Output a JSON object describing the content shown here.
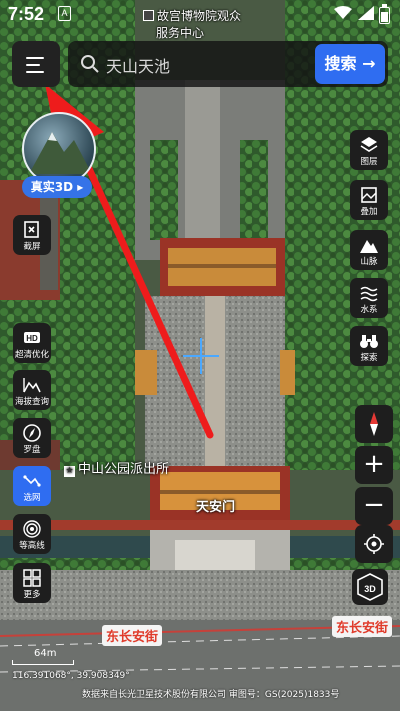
{
  "status_bar": {
    "time": "7:52",
    "notif": "A"
  },
  "map": {
    "top_poi": [
      "故宫博物院观众",
      "服务中心"
    ],
    "police_label": "中山公园派出所",
    "gate_label": "天安门",
    "road_label_left": "东长安街",
    "road_label_right": "东长安街",
    "scale_label": "64m",
    "coordinates": "116.391068°, 39.908349°",
    "credit": "数据来自长光卫星技术股份有限公司 审图号：GS(2025)1833号"
  },
  "search": {
    "value": "天山天池",
    "button": "搜索 →"
  },
  "real3d": {
    "label": "真实3D ▸"
  },
  "left_tools": [
    {
      "label": "截屏",
      "icon": "screenshot-icon"
    },
    {
      "label": "超清优化",
      "icon": "hd-icon"
    },
    {
      "label": "海拔查询",
      "icon": "altitude-icon"
    },
    {
      "label": "罗盘",
      "icon": "compass-icon"
    },
    {
      "label": "选网",
      "icon": "net-icon"
    },
    {
      "label": "等高线",
      "icon": "contour-icon"
    },
    {
      "label": "更多",
      "icon": "more-icon"
    }
  ],
  "right_tools": [
    {
      "label": "图层",
      "icon": "layers-icon"
    },
    {
      "label": "叠加",
      "icon": "overlay-icon"
    },
    {
      "label": "山脉",
      "icon": "mountain-icon"
    },
    {
      "label": "水系",
      "icon": "water-icon"
    },
    {
      "label": "探索",
      "icon": "binoculars-icon"
    }
  ],
  "map_controls": {
    "zoom_in": "+",
    "zoom_out": "−",
    "view_3d": "3D"
  },
  "colors": {
    "accent": "#2f6df1",
    "annotation_arrow": "#ee1c1c",
    "road_label": "#e03b2b"
  }
}
